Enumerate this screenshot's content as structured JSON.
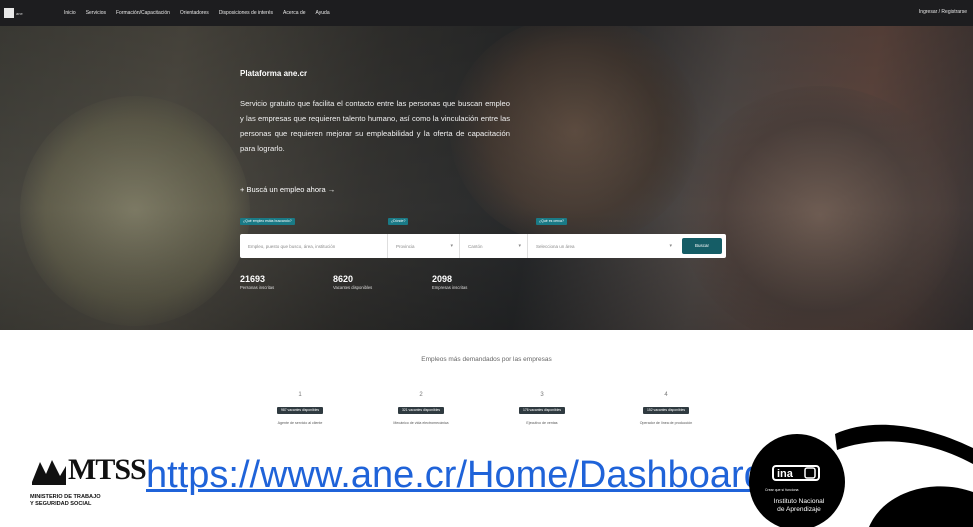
{
  "nav": {
    "logo_text": "ane",
    "items": [
      "Inicio",
      "Servicios",
      "Formación/Capacitación",
      "Orientadores",
      "Disposiciones de interés",
      "Acerca de",
      "Ayuda"
    ],
    "login": "Ingresar / Registrarse"
  },
  "hero": {
    "title": "Plataforma ane.cr",
    "description": "Servicio gratuito que facilita el contacto entre las personas que buscan empleo y las empresas que requieren talento humano, así como la vinculación entre las personas que requieren mejorar su empleabilidad y la oferta de capacitación para lograrlo.",
    "cta": "+ Buscá un empleo ahora →",
    "tags": [
      "¿Qué empleo estás buscando?",
      "¿Dónde?",
      "¿Qué es cerca?"
    ],
    "search": {
      "placeholder": "Empleo, puesto que busco, área, institución",
      "province": "Provincia",
      "canton": "Cantón",
      "area": "Selecciona un área",
      "button": "Buscar"
    },
    "stats": [
      {
        "num": "21693",
        "label": "Personas inscritas"
      },
      {
        "num": "8620",
        "label": "Vacantes disponibles"
      },
      {
        "num": "2098",
        "label": "Empresas inscritas"
      }
    ]
  },
  "section": {
    "title": "Empleos más demandados por las empresas",
    "jobs": [
      {
        "n": "1",
        "badge": "987 vacantes disponibles",
        "title": "Agente de servicio al cliente"
      },
      {
        "n": "2",
        "badge": "321 vacantes disponibles",
        "title": "Mecánico de vida electromecánica"
      },
      {
        "n": "3",
        "badge": "176 vacantes disponibles",
        "title": "Ejecutivo de ventas"
      },
      {
        "n": "4",
        "badge": "152 vacantes disponibles",
        "title": "Operador de línea de producción"
      }
    ]
  },
  "footer": {
    "mtss_word": "MTSS",
    "mtss_sub": "MINISTERIO DE TRABAJO\nY SEGURIDAD SOCIAL",
    "url": "https://www.ane.cr/Home/Dashboard",
    "ina_small": "Crear que sí funciona",
    "ina_text": "Instituto Nacional\nde Aprendizaje",
    "colors": {
      "url": "#1f63d9",
      "accent": "#1a7a86",
      "button": "#155d66"
    }
  }
}
